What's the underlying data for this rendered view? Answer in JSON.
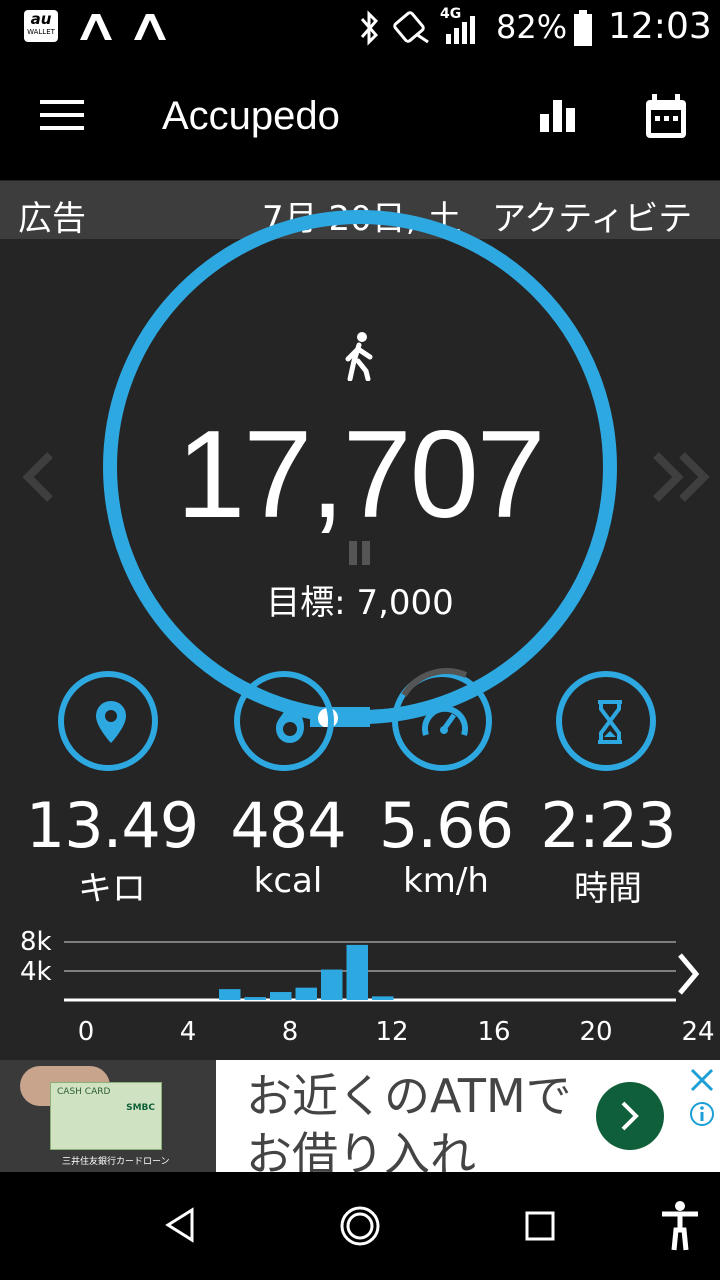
{
  "status": {
    "left_icons": [
      "au-wallet-icon",
      "a-icon",
      "a-icon"
    ],
    "wallet_top": "au",
    "wallet_bottom": "WALLET",
    "network": "4G",
    "battery": "82%",
    "time": "12:03"
  },
  "appbar": {
    "title": "Accupedo"
  },
  "subheader": {
    "ad_label": "広告",
    "date": "7月 20日, 土",
    "tab": "アクティビテ"
  },
  "steps": {
    "count": "17,707",
    "goal": "目標: 7,000",
    "progress": 1.0
  },
  "stats": [
    {
      "icon": "location-pin-icon",
      "value": "13.49",
      "unit": "キロ"
    },
    {
      "icon": "flame-icon",
      "value": "484",
      "unit": "kcal"
    },
    {
      "icon": "speedometer-icon",
      "value": "5.66",
      "unit": "km/h"
    },
    {
      "icon": "hourglass-icon",
      "value": "2:23",
      "unit": "時間"
    }
  ],
  "chart_data": {
    "type": "bar",
    "x": [
      6,
      7,
      8,
      9,
      10,
      11,
      12
    ],
    "values": [
      1500,
      400,
      1100,
      1700,
      4200,
      7600,
      500
    ],
    "xticks": [
      "0",
      "4",
      "8",
      "12",
      "16",
      "20",
      "24"
    ],
    "yticks": [
      "8k",
      "4k"
    ],
    "xlim": [
      0,
      24
    ],
    "ylim": [
      0,
      8000
    ],
    "color": "#2ea8e0"
  },
  "ad": {
    "line1": "お近くのATMで",
    "line2": "お借り入れ",
    "card_text": "CASH CARD",
    "card_caption": "三井住友銀行カードローン",
    "card_brand": "SMBC"
  },
  "colors": {
    "accent": "#2ea8e0",
    "background": "#252525",
    "ad_green": "#0f5f3a"
  }
}
